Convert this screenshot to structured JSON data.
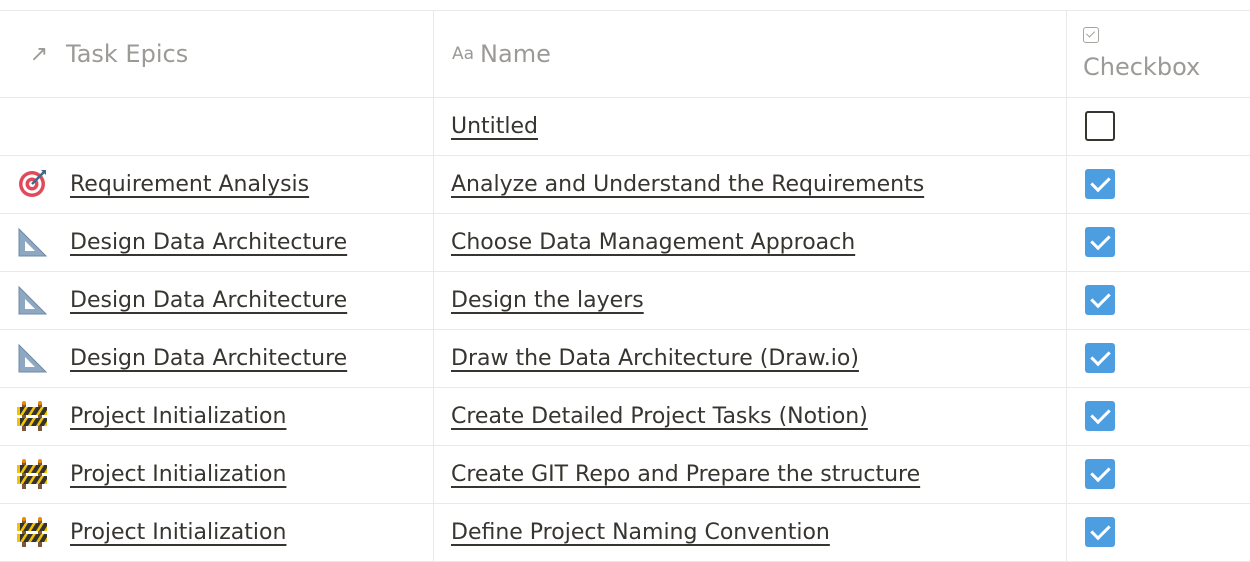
{
  "header": {
    "epic_label": "Task Epics",
    "epic_icon": "↗",
    "name_prefix": "Aa",
    "name_label": "Name",
    "checkbox_label": "Checkbox"
  },
  "rows": [
    {
      "epic": "",
      "epic_icon": "none",
      "name": "Untitled",
      "checked": false
    },
    {
      "epic": "Requirement Analysis",
      "epic_icon": "target-icon",
      "name": "Analyze and Understand the Requirements",
      "checked": true
    },
    {
      "epic": "Design Data Architecture",
      "epic_icon": "triangular-ruler-icon",
      "name": "Choose Data Management Approach",
      "checked": true
    },
    {
      "epic": "Design Data Architecture",
      "epic_icon": "triangular-ruler-icon",
      "name": "Design the layers",
      "checked": true
    },
    {
      "epic": "Design Data Architecture",
      "epic_icon": "triangular-ruler-icon",
      "name": "Draw the Data Architecture (Draw.io)",
      "checked": true
    },
    {
      "epic": "Project Initialization",
      "epic_icon": "construction-barrier-icon",
      "name": "Create Detailed Project Tasks (Notion)",
      "checked": true
    },
    {
      "epic": "Project Initialization",
      "epic_icon": "construction-barrier-icon",
      "name": "Create GIT Repo and Prepare the structure",
      "checked": true
    },
    {
      "epic": "Project Initialization",
      "epic_icon": "construction-barrier-icon",
      "name": "Define Project Naming Convention",
      "checked": true
    }
  ],
  "colors": {
    "checkbox_checked": "#4c9ee0",
    "text": "#37352f",
    "header_text": "#9b9a97",
    "border": "#e9e9e7"
  }
}
